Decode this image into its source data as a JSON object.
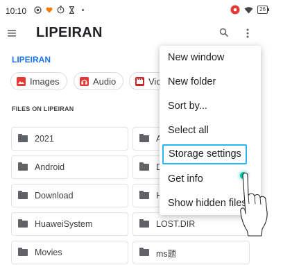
{
  "status_bar": {
    "time": "10:10",
    "battery": "26"
  },
  "app_bar": {
    "title": "LIPEIRAN",
    "icons": [
      "menu-icon",
      "search-icon",
      "more-vert-icon"
    ]
  },
  "breadcrumb": "LIPEIRAN",
  "chips": [
    {
      "label": "Images",
      "icon": "image-icon",
      "color": "#e53935"
    },
    {
      "label": "Audio",
      "icon": "audio-icon",
      "color": "#e53935"
    },
    {
      "label": "Vic",
      "icon": "video-icon",
      "color": "#c62828"
    }
  ],
  "section_header": "FILES ON LIPEIRAN",
  "files_left": [
    "2021",
    "Android",
    "Download",
    "HuaweiSystem",
    "Movies"
  ],
  "files_right": [
    "A",
    "D",
    "H",
    "LOST.DIR",
    "ms题"
  ],
  "overflow_menu": {
    "items": [
      "New window",
      "New folder",
      "Sort by...",
      "Select all",
      "Storage settings",
      "Get info",
      "Show hidden files"
    ],
    "highlighted_index": 4
  },
  "colors": {
    "accent": "#1a73e8",
    "highlight_border": "#29b6f6",
    "touch": "#00bfa5",
    "chip_icon": "#e53935"
  }
}
